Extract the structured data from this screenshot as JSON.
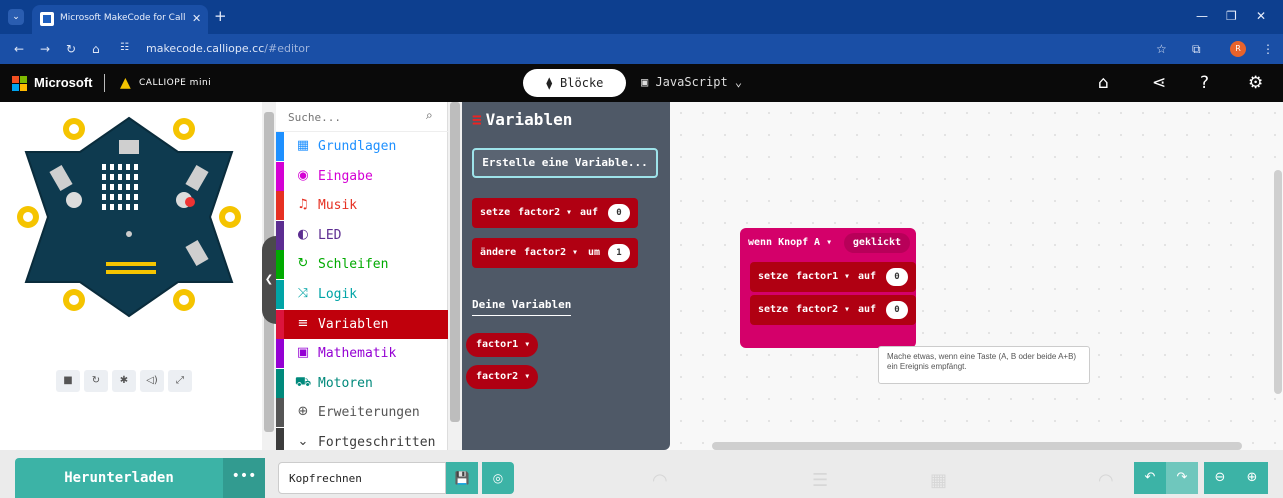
{
  "browser": {
    "tab_title": "Microsoft MakeCode for Callio",
    "url_host": "makecode.calliope.cc",
    "url_path": "/#editor",
    "avatar_letter": "R"
  },
  "header": {
    "brand": "Microsoft",
    "product": "CALLIOPE mini",
    "blocks_label": "Blöcke",
    "js_label": "JavaScript"
  },
  "toolbox": {
    "search_placeholder": "Suche...",
    "categories": [
      {
        "label": "Grundlagen",
        "color": "#1e90ff",
        "icon": "grid-icon",
        "glyph": "▦"
      },
      {
        "label": "Eingabe",
        "color": "#d400d4",
        "icon": "target-icon",
        "glyph": "◉"
      },
      {
        "label": "Musik",
        "color": "#e63022",
        "icon": "headphones-icon",
        "glyph": "♫"
      },
      {
        "label": "LED",
        "color": "#5c2d91",
        "icon": "toggle-icon",
        "glyph": "◐"
      },
      {
        "label": "Schleifen",
        "color": "#00aa00",
        "icon": "loop-icon",
        "glyph": "↻"
      },
      {
        "label": "Logik",
        "color": "#00a4a6",
        "icon": "shuffle-icon",
        "glyph": "⤨"
      },
      {
        "label": "Variablen",
        "color": "#dc143c",
        "icon": "list-icon",
        "glyph": "≡"
      },
      {
        "label": "Mathematik",
        "color": "#9400d3",
        "icon": "calculator-icon",
        "glyph": "▣"
      },
      {
        "label": "Motoren",
        "color": "#00897b",
        "icon": "car-icon",
        "glyph": "⛟"
      },
      {
        "label": "Erweiterungen",
        "color": "#555555",
        "icon": "plus-icon",
        "glyph": "⊕"
      },
      {
        "label": "Fortgeschritten",
        "color": "#3c3c3c",
        "icon": "chevron-icon",
        "glyph": "⌄"
      }
    ]
  },
  "flyout": {
    "title": "Variablen",
    "create_label": "Erstelle eine Variable...",
    "set_block": {
      "verb": "setze",
      "var": "factor2",
      "prep": "auf",
      "value": "0"
    },
    "change_block": {
      "verb": "ändere",
      "var": "factor2",
      "prep": "um",
      "value": "1"
    },
    "your_vars_label": "Deine Variablen",
    "variables": [
      "factor1",
      "factor2"
    ]
  },
  "workspace": {
    "event": {
      "head": "wenn Knopf",
      "button": "A",
      "action": "geklickt"
    },
    "statements": [
      {
        "verb": "setze",
        "var": "factor1",
        "prep": "auf",
        "value": "0"
      },
      {
        "verb": "setze",
        "var": "factor2",
        "prep": "auf",
        "value": "0"
      }
    ],
    "tooltip": "Mache etwas, wenn eine Taste (A, B oder beide A+B) ein Ereignis empfängt."
  },
  "footer": {
    "download_label": "Herunterladen",
    "more_label": "•••",
    "project_name": "Kopfrechnen"
  }
}
